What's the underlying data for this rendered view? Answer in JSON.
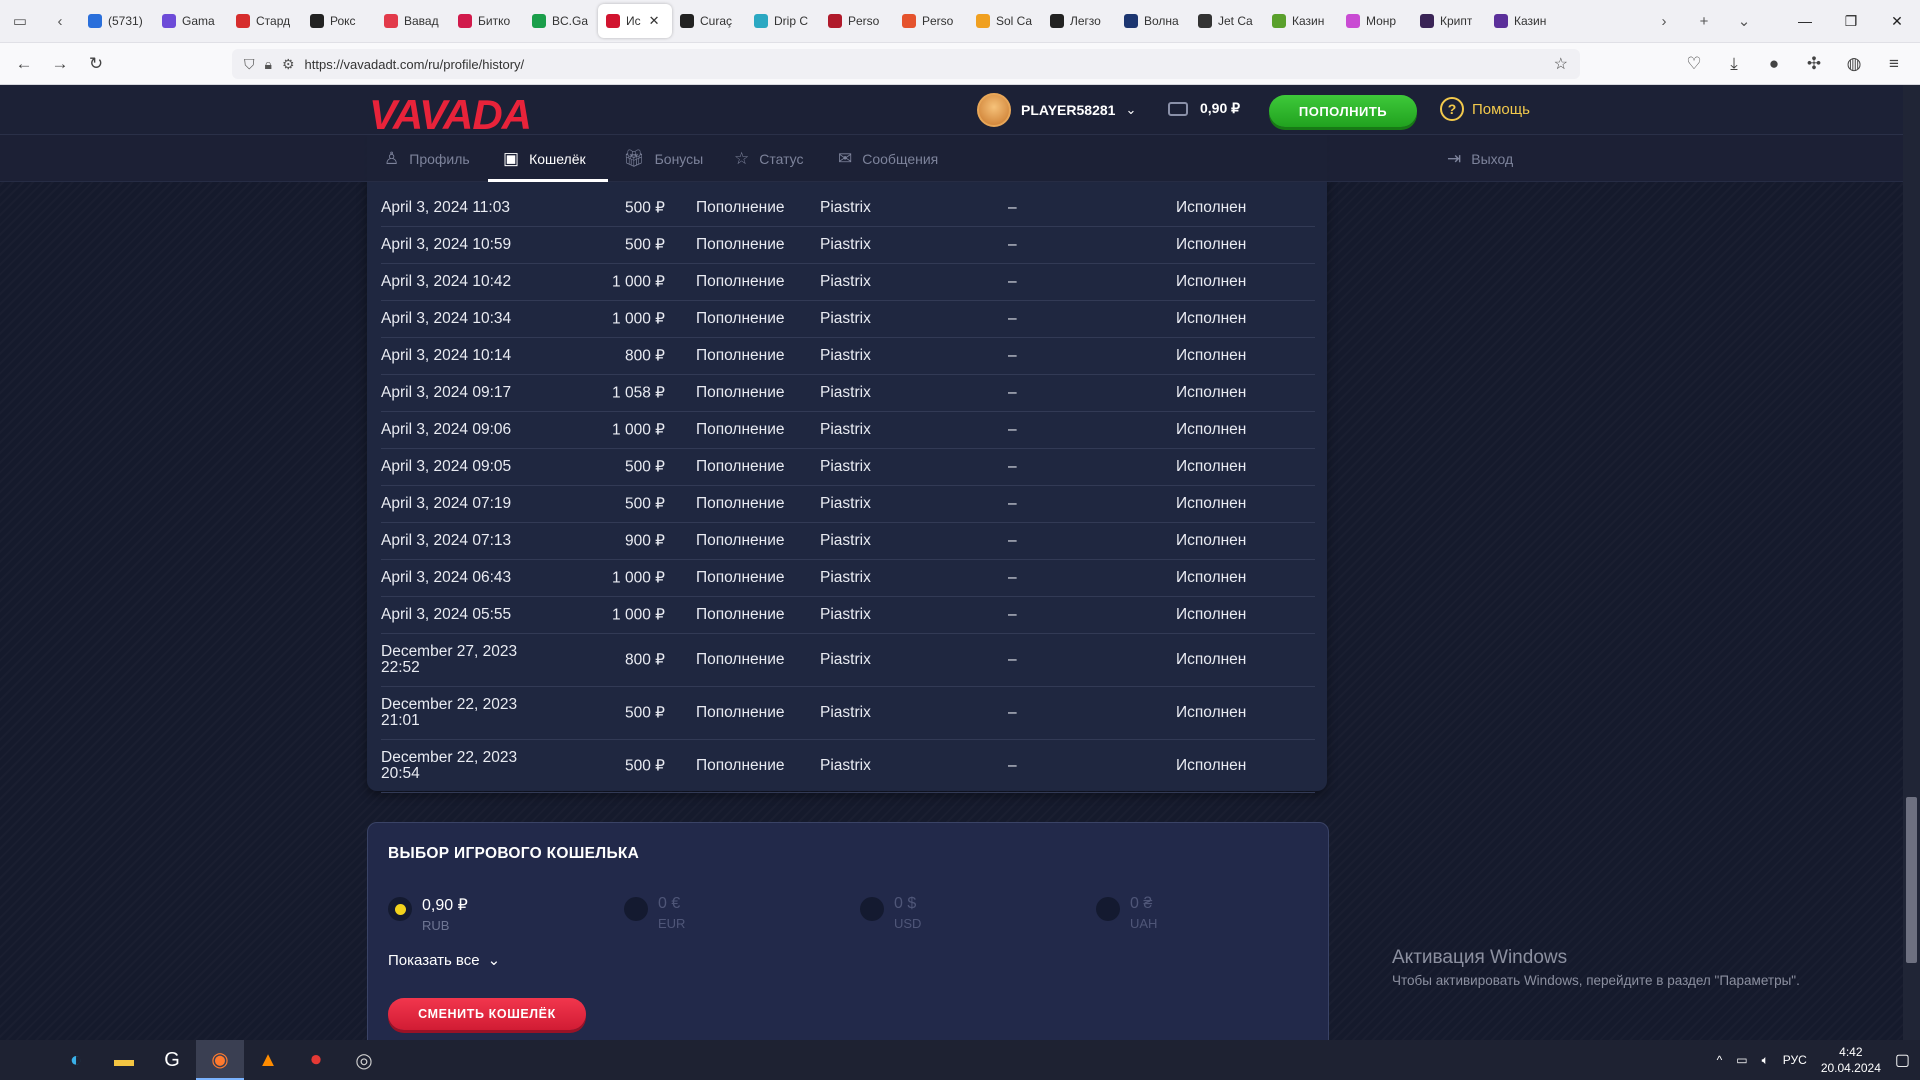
{
  "browser": {
    "tabs": [
      {
        "label": "(5731)",
        "color": "#2a6fdb"
      },
      {
        "label": "Gama",
        "color": "#6d4bd8"
      },
      {
        "label": "Стард",
        "color": "#d62d2d"
      },
      {
        "label": "Рокс",
        "color": "#222222"
      },
      {
        "label": "Вавад",
        "color": "#e23a4a"
      },
      {
        "label": "Битко",
        "color": "#d11a4b"
      },
      {
        "label": "BC.Ga",
        "color": "#1a9e4a"
      },
      {
        "label": "Ис",
        "color": "#d1142f"
      },
      {
        "label": "Curaç",
        "color": "#222222"
      },
      {
        "label": "Drip C",
        "color": "#2ba8c2"
      },
      {
        "label": "Perso",
        "color": "#b01a2b"
      },
      {
        "label": "Perso",
        "color": "#e5532d"
      },
      {
        "label": "Sol Ca",
        "color": "#f0a020"
      },
      {
        "label": "Легзо",
        "color": "#222222"
      },
      {
        "label": "Волна",
        "color": "#1c3570"
      },
      {
        "label": "Jet Ca",
        "color": "#333333"
      },
      {
        "label": "Казин",
        "color": "#5aa02c"
      },
      {
        "label": "Монр",
        "color": "#c94bd3"
      },
      {
        "label": "Крипт",
        "color": "#3a2456"
      },
      {
        "label": "Казин",
        "color": "#5b2f9a"
      }
    ],
    "active_tab_index": 7,
    "url": "https://vavadadt.com/ru/profile/history/"
  },
  "site": {
    "logo": "VAVADA",
    "username": "PLAYER58281",
    "balance": "0,90 ₽",
    "deposit_label": "ПОПОЛНИТЬ",
    "help_label": "Помощь",
    "subnav": {
      "profile": "Профиль",
      "wallet": "Кошелёк",
      "bonuses": "Бонусы",
      "status": "Статус",
      "messages": "Сообщения",
      "logout": "Выход"
    }
  },
  "history": {
    "ghost_rows": [
      {
        "amount": "500 ₽",
        "type": "Пополнение",
        "system": "Piastrix",
        "dash": "–",
        "status": "Исполнен"
      }
    ],
    "rows": [
      {
        "date": "April 3, 2024 11:03",
        "amount": "500 ₽",
        "type": "Пополнение",
        "system": "Piastrix",
        "dash": "–",
        "status": "Исполнен"
      },
      {
        "date": "April 3, 2024 10:59",
        "amount": "500 ₽",
        "type": "Пополнение",
        "system": "Piastrix",
        "dash": "–",
        "status": "Исполнен"
      },
      {
        "date": "April 3, 2024 10:42",
        "amount": "1 000 ₽",
        "type": "Пополнение",
        "system": "Piastrix",
        "dash": "–",
        "status": "Исполнен"
      },
      {
        "date": "April 3, 2024 10:34",
        "amount": "1 000 ₽",
        "type": "Пополнение",
        "system": "Piastrix",
        "dash": "–",
        "status": "Исполнен"
      },
      {
        "date": "April 3, 2024 10:14",
        "amount": "800 ₽",
        "type": "Пополнение",
        "system": "Piastrix",
        "dash": "–",
        "status": "Исполнен"
      },
      {
        "date": "April 3, 2024 09:17",
        "amount": "1 058 ₽",
        "type": "Пополнение",
        "system": "Piastrix",
        "dash": "–",
        "status": "Исполнен"
      },
      {
        "date": "April 3, 2024 09:06",
        "amount": "1 000 ₽",
        "type": "Пополнение",
        "system": "Piastrix",
        "dash": "–",
        "status": "Исполнен"
      },
      {
        "date": "April 3, 2024 09:05",
        "amount": "500 ₽",
        "type": "Пополнение",
        "system": "Piastrix",
        "dash": "–",
        "status": "Исполнен"
      },
      {
        "date": "April 3, 2024 07:19",
        "amount": "500 ₽",
        "type": "Пополнение",
        "system": "Piastrix",
        "dash": "–",
        "status": "Исполнен"
      },
      {
        "date": "April 3, 2024 07:13",
        "amount": "900 ₽",
        "type": "Пополнение",
        "system": "Piastrix",
        "dash": "–",
        "status": "Исполнен"
      },
      {
        "date": "April 3, 2024 06:43",
        "amount": "1 000 ₽",
        "type": "Пополнение",
        "system": "Piastrix",
        "dash": "–",
        "status": "Исполнен"
      },
      {
        "date": "April 3, 2024 05:55",
        "amount": "1 000 ₽",
        "type": "Пополнение",
        "system": "Piastrix",
        "dash": "–",
        "status": "Исполнен"
      },
      {
        "date": "December 27, 2023 22:52",
        "amount": "800 ₽",
        "type": "Пополнение",
        "system": "Piastrix",
        "dash": "–",
        "status": "Исполнен"
      },
      {
        "date": "December 22, 2023 21:01",
        "amount": "500 ₽",
        "type": "Пополнение",
        "system": "Piastrix",
        "dash": "–",
        "status": "Исполнен"
      },
      {
        "date": "December 22, 2023 20:54",
        "amount": "500 ₽",
        "type": "Пополнение",
        "system": "Piastrix",
        "dash": "–",
        "status": "Исполнен"
      }
    ]
  },
  "wallet_select": {
    "title": "ВЫБОР ИГРОВОГО КОШЕЛЬКА",
    "currencies": [
      {
        "amount": "0,90 ₽",
        "code": "RUB",
        "selected": true
      },
      {
        "amount": "0 €",
        "code": "EUR",
        "selected": false
      },
      {
        "amount": "0 $",
        "code": "USD",
        "selected": false
      },
      {
        "amount": "0 ₴",
        "code": "UAH",
        "selected": false
      }
    ],
    "show_all_label": "Показать все",
    "change_button": "СМЕНИТЬ КОШЕЛЁК"
  },
  "windows": {
    "activation_title": "Активация Windows",
    "activation_sub": "Чтобы активировать Windows, перейдите в раздел \"Параметры\".",
    "lang": "РУС",
    "time": "4:42",
    "date": "20.04.2024"
  },
  "colors": {
    "brand_red": "#e8233a",
    "deposit_green": "#2bb528",
    "help_yellow": "#f2c94c",
    "radio_selected": "#f2d21c"
  }
}
